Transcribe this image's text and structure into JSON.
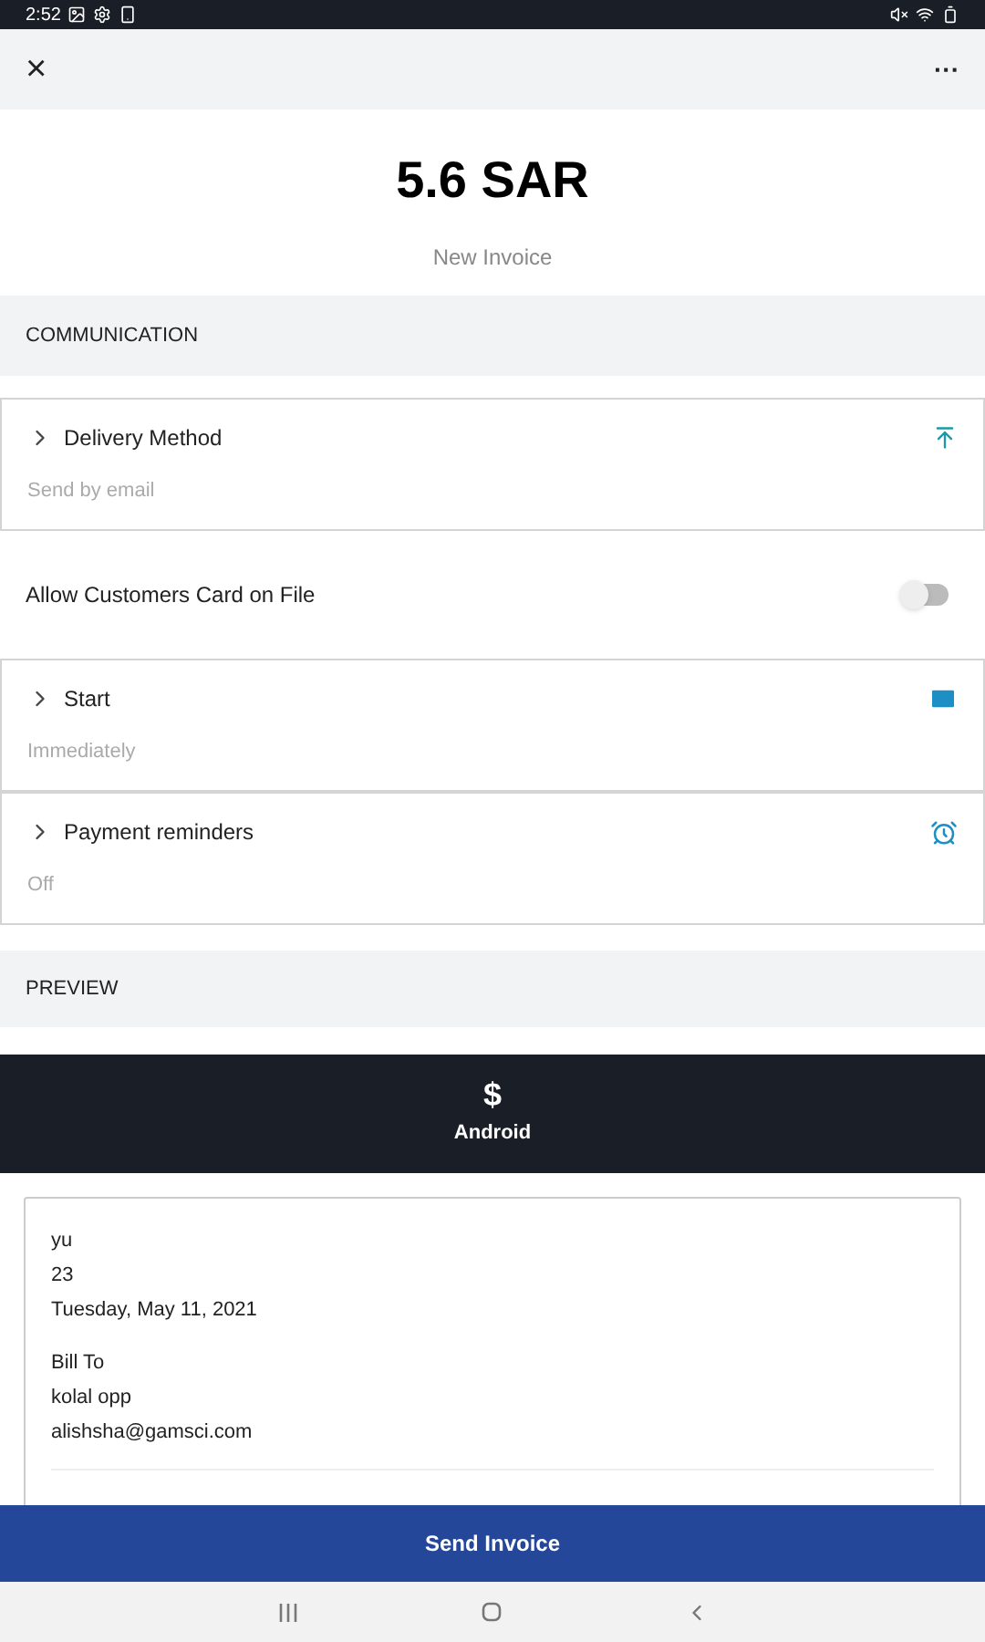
{
  "status_bar": {
    "time": "2:52"
  },
  "header": {
    "close": "×",
    "more": "···"
  },
  "invoice": {
    "amount": "5.6 SAR",
    "subtitle": "New Invoice"
  },
  "communication": {
    "heading": "COMMUNICATION",
    "rows": [
      {
        "kind": "expand",
        "label": "Delivery Method",
        "value": "Send by email"
      },
      {
        "kind": "toggle",
        "label": "Allow Customers Card on File",
        "on": false
      },
      {
        "kind": "expand",
        "label": "Start",
        "value": "Immediately"
      },
      {
        "kind": "expand",
        "label": "Payment reminders",
        "value": "Off"
      }
    ]
  },
  "preview": {
    "heading": "PREVIEW",
    "symbol": "$",
    "business": "Android",
    "lines": [
      "yu",
      "23",
      "Tuesday, May 11, 2021"
    ],
    "bill_to": [
      "Bill To",
      "kolal opp",
      "alishsha@gamsci.com"
    ]
  },
  "send_button": "Send Invoice"
}
